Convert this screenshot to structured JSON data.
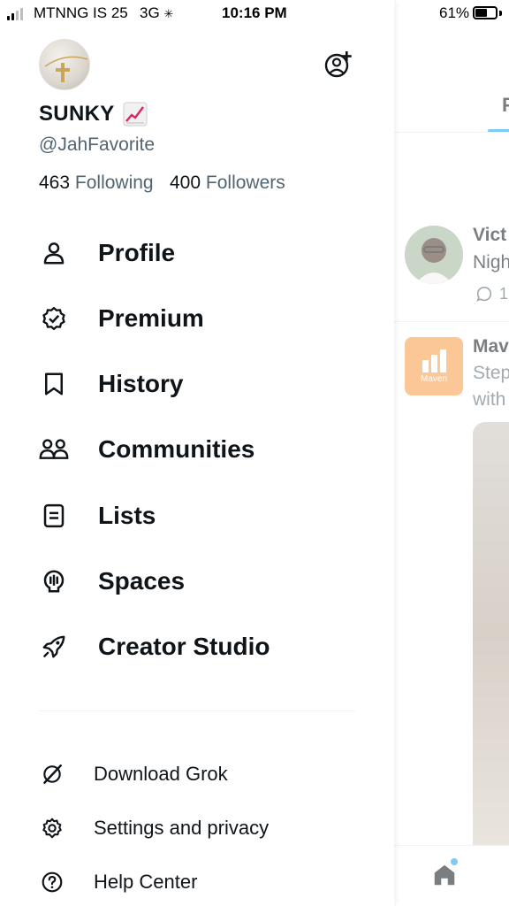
{
  "status_bar": {
    "carrier": "MTNNG IS 25",
    "network": "3G",
    "time": "10:16 PM",
    "battery_percent_text": "61%",
    "battery_level": 0.61,
    "signal_bars_active": 2
  },
  "profile": {
    "display_name": "SUNKY",
    "name_emoji": "chart-increasing-emoji",
    "handle": "@JahFavorite",
    "following_count": "463",
    "following_label": "Following",
    "followers_count": "400",
    "followers_label": "Followers"
  },
  "nav": {
    "items": [
      {
        "label": "Profile",
        "icon": "person-icon"
      },
      {
        "label": "Premium",
        "icon": "verified-badge-icon"
      },
      {
        "label": "History",
        "icon": "bookmark-icon"
      },
      {
        "label": "Communities",
        "icon": "people-icon"
      },
      {
        "label": "Lists",
        "icon": "list-icon"
      },
      {
        "label": "Spaces",
        "icon": "microphone-icon"
      },
      {
        "label": "Creator Studio",
        "icon": "rocket-icon"
      }
    ]
  },
  "secondary": {
    "items": [
      {
        "label": "Download Grok",
        "icon": "grok-icon"
      },
      {
        "label": "Settings and privacy",
        "icon": "gear-icon"
      },
      {
        "label": "Help Center",
        "icon": "help-icon"
      }
    ]
  },
  "feed": {
    "tab_partial": "F",
    "post1": {
      "name_partial": "Vict",
      "text_partial": "Nigh",
      "reply_count_partial": "1"
    },
    "post2": {
      "name_partial": "Mav",
      "text_line1_partial": "Step",
      "text_line2_partial": "with",
      "logo_text": "Maven"
    },
    "colors": {
      "accent": "#1d9bf0",
      "maven_orange": "#f79a42"
    }
  }
}
